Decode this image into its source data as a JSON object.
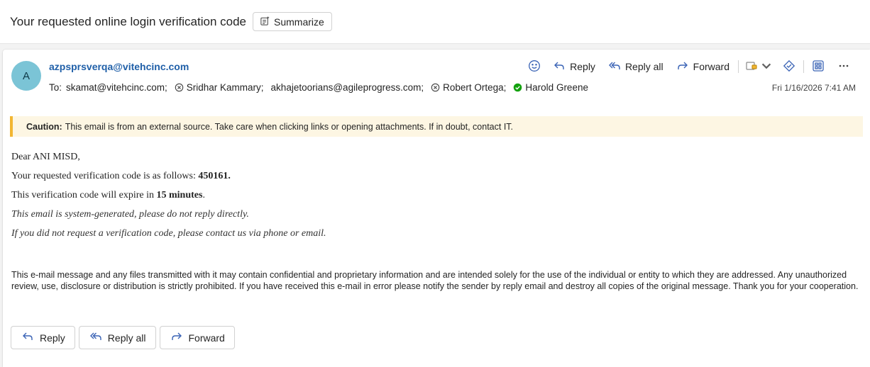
{
  "subject": {
    "title": "Your requested online login verification code",
    "summarize_label": "Summarize"
  },
  "message": {
    "avatar_initial": "A",
    "sender": "azpsprsverqa@vitehcinc.com",
    "to_label": "To:",
    "recipients": [
      {
        "name": "skamat@vitehcinc.com;",
        "status": "none"
      },
      {
        "name": "Sridhar Kammary;",
        "status": "blocked"
      },
      {
        "name": "akhajetoorians@agileprogress.com;",
        "status": "none"
      },
      {
        "name": "Robert Ortega;",
        "status": "blocked"
      },
      {
        "name": "Harold Greene",
        "status": "available"
      }
    ],
    "datetime": "Fri 1/16/2026 7:41 AM"
  },
  "toolbar": {
    "reply_label": "Reply",
    "reply_all_label": "Reply all",
    "forward_label": "Forward",
    "icons": [
      "smiley-icon",
      "reply-icon",
      "reply-all-icon",
      "forward-icon",
      "apps-dropdown-icon",
      "sticker-icon",
      "grid-icon",
      "more-icon"
    ]
  },
  "caution": {
    "label": "Caution:",
    "text": "This email is from an external source. Take care when clicking links or opening attachments. If in doubt, contact IT."
  },
  "body": {
    "greeting": "Dear ANI MISD,",
    "code_prefix": "Your requested verification code is as follows: ",
    "code": "450161.",
    "expire_prefix": "This verification code will expire in ",
    "expire_value": "15 minutes",
    "expire_suffix": ".",
    "note1": "This email is system-generated, please do not reply directly.",
    "note2": "If you did not request a verification code, please contact us via phone or email."
  },
  "disclaimer": "This e-mail message and any files transmitted with it may contain confidential and proprietary information and are intended solely for the use of the individual or entity to which they are addressed. Any unauthorized review, use, disclosure or distribution is strictly prohibited. If you have received this e-mail in error please notify the sender by reply email and destroy all copies of the original message. Thank you for your cooperation.",
  "actions": {
    "reply_label": "Reply",
    "reply_all_label": "Reply all",
    "forward_label": "Forward"
  },
  "colors": {
    "sender_link": "#1f5fa8",
    "avatar_bg": "#7bc4d6",
    "caution_bg": "#fdf6e3",
    "caution_accent": "#f2b632",
    "toolbar_icon": "#3a63b5",
    "available_status": "#13a10e"
  }
}
